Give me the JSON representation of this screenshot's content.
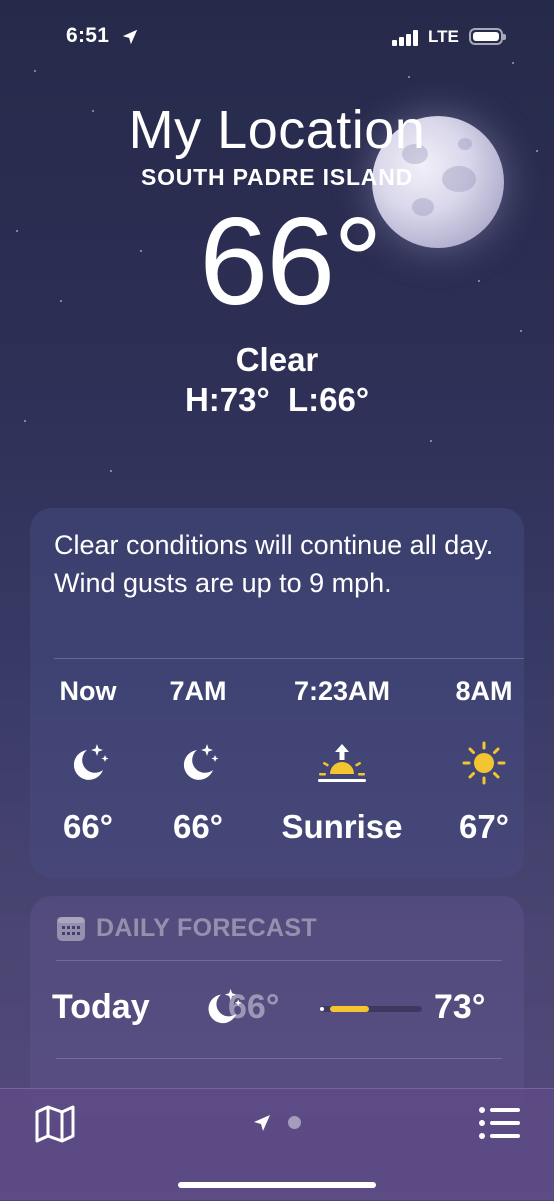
{
  "status_bar": {
    "time": "6:51",
    "network": "LTE"
  },
  "header": {
    "location": "My Location",
    "place": "SOUTH PADRE ISLAND",
    "temperature": "66°",
    "condition": "Clear",
    "high_low": "H:73°  L:66°"
  },
  "hourly": {
    "summary": "Clear conditions will continue all day. Wind gusts are up to 9 mph.",
    "items": [
      {
        "time": "Now",
        "icon": "moon-stars-icon",
        "value": "66°"
      },
      {
        "time": "7AM",
        "icon": "moon-stars-icon",
        "value": "66°"
      },
      {
        "time": "7:23AM",
        "icon": "sunrise-icon",
        "value": "Sunrise"
      },
      {
        "time": "8AM",
        "icon": "sun-icon",
        "value": "67°"
      }
    ]
  },
  "daily": {
    "heading": "DAILY FORECAST",
    "rows": [
      {
        "day": "Today",
        "icon": "moon-stars-icon",
        "low": "66°",
        "high": "73°",
        "range_start_fraction": 0.1,
        "range_end_fraction": 0.48
      }
    ]
  },
  "toolbar": {
    "left_icon": "map-icon",
    "center_icons": [
      "location-arrow-icon",
      "page-dot"
    ],
    "right_icon": "list-icon"
  },
  "colors": {
    "accent_sun": "#f2c531",
    "background_top": "#262a4a",
    "background_bottom": "#574b7e"
  }
}
